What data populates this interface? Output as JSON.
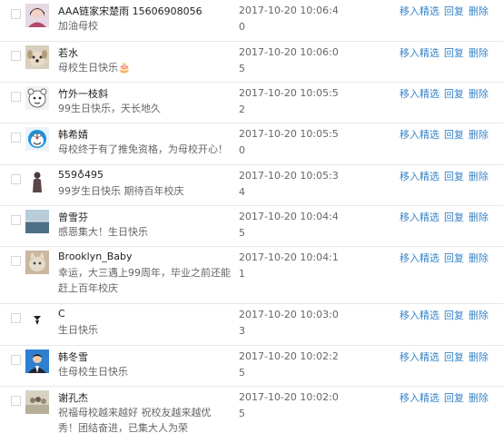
{
  "actions": {
    "feature": "移入精选",
    "reply": "回复",
    "delete": "删除"
  },
  "comments": [
    {
      "name": "AAA链家宋楚雨 15606908056",
      "message": "加油母校",
      "time": "2017-10-20 10:06:40",
      "avatar": "girl-portrait"
    },
    {
      "name": "若水",
      "message": "母校生日快乐🎂",
      "time": "2017-10-20 10:06:05",
      "avatar": "dog"
    },
    {
      "name": "竹外一枝斜",
      "message": "99生日快乐，天长地久",
      "time": "2017-10-20 10:05:52",
      "avatar": "cartoon-bear"
    },
    {
      "name": "韩希婧",
      "message": "母校终于有了推免资格，为母校开心！",
      "time": "2017-10-20 10:05:50",
      "avatar": "doraemon"
    },
    {
      "name": "559♁495",
      "message": "99岁生日快乐 期待百年校庆",
      "time": "2017-10-20 10:05:34",
      "avatar": "silhouette"
    },
    {
      "name": "曾雪芬",
      "message": "感恩集大！生日快乐",
      "time": "2017-10-20 10:04:45",
      "avatar": "sea"
    },
    {
      "name": "Brooklyn_Baby",
      "message": "幸运，大三遇上99周年，毕业之前还能赶上百年校庆",
      "time": "2017-10-20 10:04:11",
      "avatar": "cat"
    },
    {
      "name": "C",
      "message": "生日快乐",
      "time": "2017-10-20 10:03:03",
      "avatar": "logo-mark"
    },
    {
      "name": "韩冬雪",
      "message": "住母校生日快乐",
      "time": "2017-10-20 10:02:25",
      "avatar": "man-suit"
    },
    {
      "name": "谢孔杰",
      "message": "祝福母校越来越好 祝校友越来越优秀！团结奋进，已集大人为荣",
      "time": "2017-10-20 10:02:05",
      "avatar": "group-photo"
    }
  ]
}
